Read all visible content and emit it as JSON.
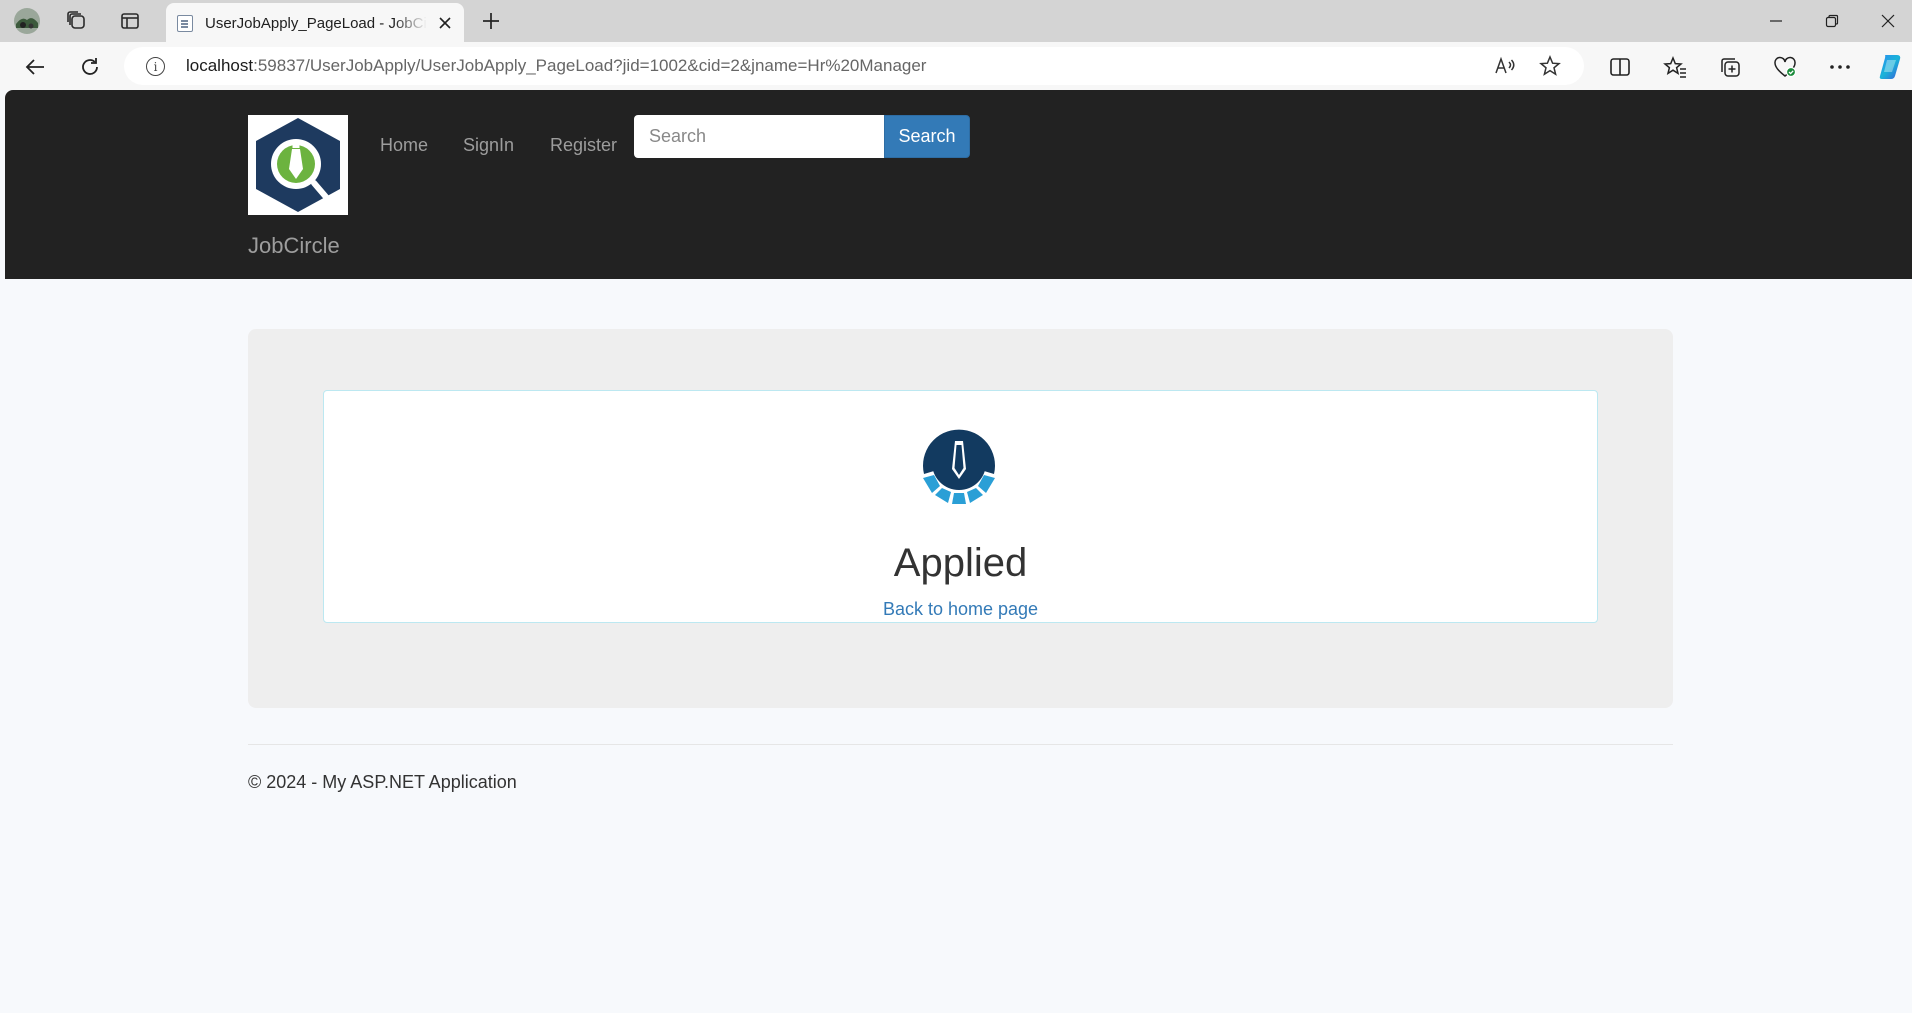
{
  "browser": {
    "tab": {
      "title": "UserJobApply_PageLoad - JobCircle"
    },
    "url": {
      "host": "localhost",
      "rest": ":59837/UserJobApply/UserJobApply_PageLoad?jid=1002&cid=2&jname=Hr%20Manager"
    },
    "icons": [
      "profile-icon",
      "workspaces-icon",
      "vertical-tabs-icon",
      "page-icon",
      "close-icon",
      "plus-icon",
      "minimize-icon",
      "restore-icon",
      "close-icon",
      "back-icon",
      "refresh-icon",
      "info-icon",
      "read-aloud-icon",
      "favorite-star-icon",
      "split-screen-icon",
      "favorites-icon",
      "collections-icon",
      "browser-essentials-icon",
      "more-icon",
      "copilot-icon"
    ]
  },
  "navbar": {
    "brand": "JobCircle",
    "links": [
      "Home",
      "SignIn",
      "Register"
    ],
    "search_placeholder": "Search",
    "search_button": "Search"
  },
  "main": {
    "heading": "Applied",
    "back_link": "Back to home page"
  },
  "footer": {
    "text": "© 2024 - My ASP.NET Application"
  },
  "colors": {
    "navbar_bg": "#222222",
    "primary_button": "#337ab7",
    "logo_navy": "#1e3a5f",
    "logo_green": "#6cb33f",
    "logo_blue": "#2a9fd6",
    "jumbotron_bg": "#eeeeee"
  }
}
